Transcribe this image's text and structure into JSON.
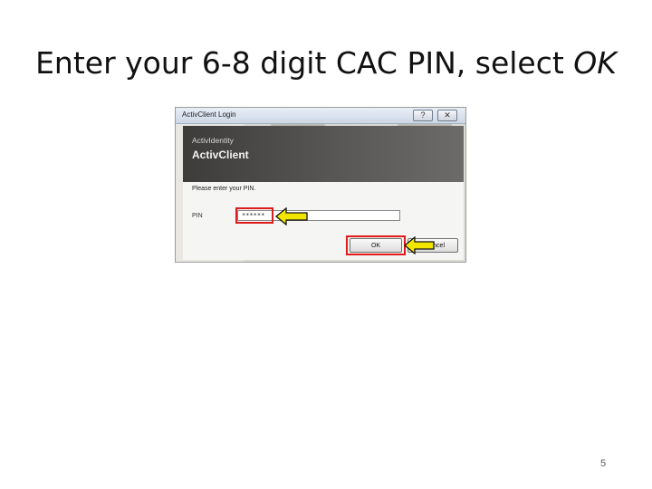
{
  "slide": {
    "title_prefix": "Enter your 6-8 digit CAC PIN, select ",
    "title_emphasis": "OK",
    "page_number": "5"
  },
  "dialog": {
    "window_title": "ActivClient Login",
    "help_button": "?",
    "close_button": "✕",
    "brand": "ActivIdentity",
    "product": "ActivClient",
    "prompt": "Please enter your PIN.",
    "pin_label": "PIN",
    "pin_value": "******",
    "ok_label": "OK",
    "cancel_label": "ncel"
  },
  "colors": {
    "highlight": "#e01b1b",
    "arrow_fill": "#f2e600"
  }
}
